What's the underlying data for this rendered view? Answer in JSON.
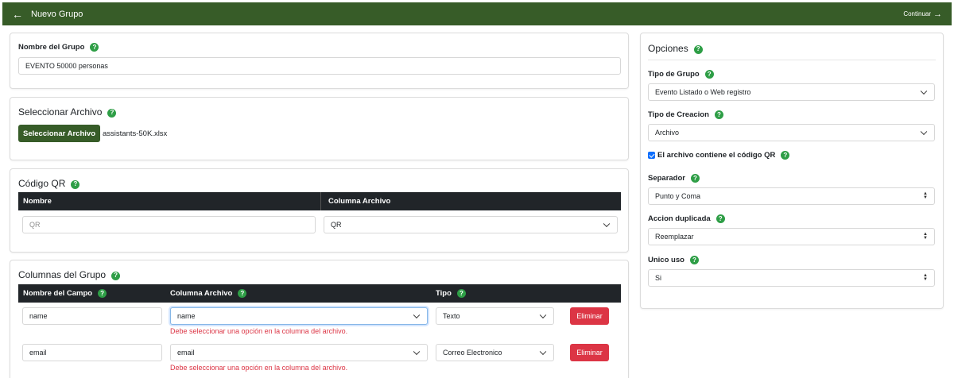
{
  "header": {
    "back_icon": "arrow-left-icon",
    "title": "Nuevo Grupo",
    "continue_label": "Continuar"
  },
  "group_name": {
    "label": "Nombre del Grupo",
    "value": "EVENTO 50000 personas"
  },
  "file_select": {
    "title": "Seleccionar Archivo",
    "button_label": "Seleccionar Archivo",
    "file_name": "assistants-50K.xlsx"
  },
  "qr_section": {
    "title": "Código QR",
    "col_name": "Nombre",
    "col_file": "Columna Archivo",
    "name_placeholder": "QR",
    "file_column_value": "QR"
  },
  "group_columns": {
    "title": "Columnas del Grupo",
    "headers": [
      "Nombre del Campo",
      "Columna Archivo",
      "Tipo"
    ],
    "rows": [
      {
        "field_name": "name",
        "file_column": "name",
        "type": "Texto",
        "error": "Debe seleccionar una opción en la columna del archivo.",
        "delete_label": "Eliminar"
      },
      {
        "field_name": "email",
        "file_column": "email",
        "type": "Correo Electronico",
        "error": "Debe seleccionar una opción en la columna del archivo.",
        "delete_label": "Eliminar"
      }
    ]
  },
  "options": {
    "title": "Opciones",
    "group_type_label": "Tipo de Grupo",
    "group_type_value": "Evento Listado o Web registro",
    "creation_type_label": "Tipo de Creacion",
    "creation_type_value": "Archivo",
    "qr_checkbox_label": "El archivo contiene el código QR",
    "qr_checkbox_checked": true,
    "separator_label": "Separador",
    "separator_value": "Punto y Coma",
    "duplicate_label": "Accion duplicada",
    "duplicate_value": "Reemplazar",
    "single_use_label": "Unico uso",
    "single_use_value": "Si"
  },
  "colors": {
    "brand_green": "#375c28",
    "help_green": "#2e9e46",
    "danger": "#dc3545",
    "table_header": "#212529",
    "checkbox": "#0d6efd"
  }
}
